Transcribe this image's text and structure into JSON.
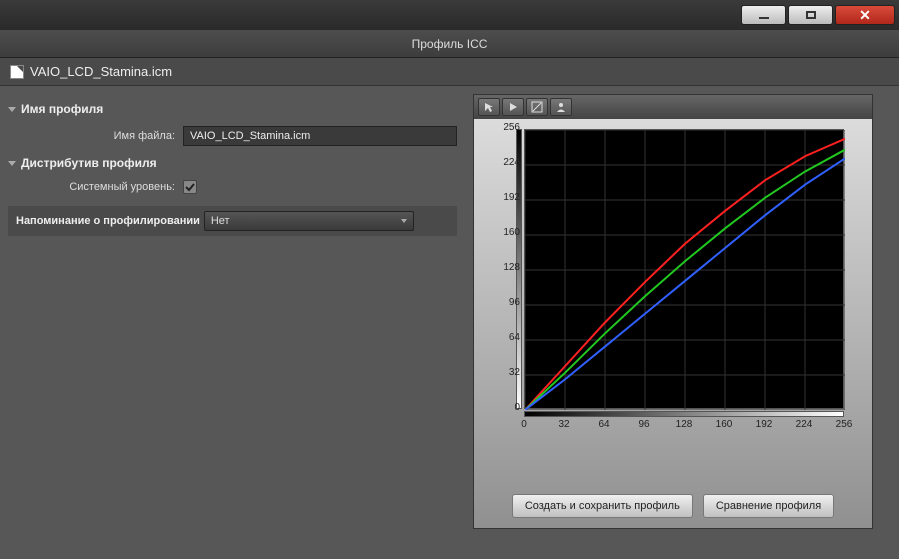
{
  "header": {
    "title": "Профиль ICC"
  },
  "file": {
    "name": "VAIO_LCD_Stamina.icm"
  },
  "sections": {
    "profile_name": {
      "title": "Имя профиля",
      "file_label": "Имя файла:",
      "file_value": "VAIO_LCD_Stamina.icm"
    },
    "distribution": {
      "title": "Дистрибутив профиля",
      "system_level_label": "Системный уровень:",
      "system_level_checked": true
    },
    "reminder": {
      "label": "Напоминание о профилировании",
      "value": "Нет"
    }
  },
  "buttons": {
    "create_save": "Создать и сохранить профиль",
    "compare": "Сравнение профиля"
  },
  "chart_data": {
    "type": "line",
    "xlabel": "",
    "ylabel": "",
    "xlim": [
      0,
      256
    ],
    "ylim": [
      0,
      256
    ],
    "x_ticks": [
      0,
      32,
      64,
      96,
      128,
      160,
      192,
      224,
      256
    ],
    "y_ticks": [
      0,
      32,
      64,
      96,
      128,
      160,
      192,
      224,
      256
    ],
    "x": [
      0,
      32,
      64,
      96,
      128,
      160,
      192,
      224,
      256
    ],
    "series": [
      {
        "name": "Red",
        "color": "#ff2020",
        "values": [
          0,
          40,
          80,
          117,
          152,
          182,
          210,
          232,
          248
        ]
      },
      {
        "name": "Green",
        "color": "#20c820",
        "values": [
          0,
          34,
          70,
          104,
          136,
          166,
          194,
          218,
          238
        ]
      },
      {
        "name": "Blue",
        "color": "#3060ff",
        "values": [
          0,
          28,
          58,
          88,
          118,
          148,
          178,
          206,
          230
        ]
      }
    ]
  }
}
